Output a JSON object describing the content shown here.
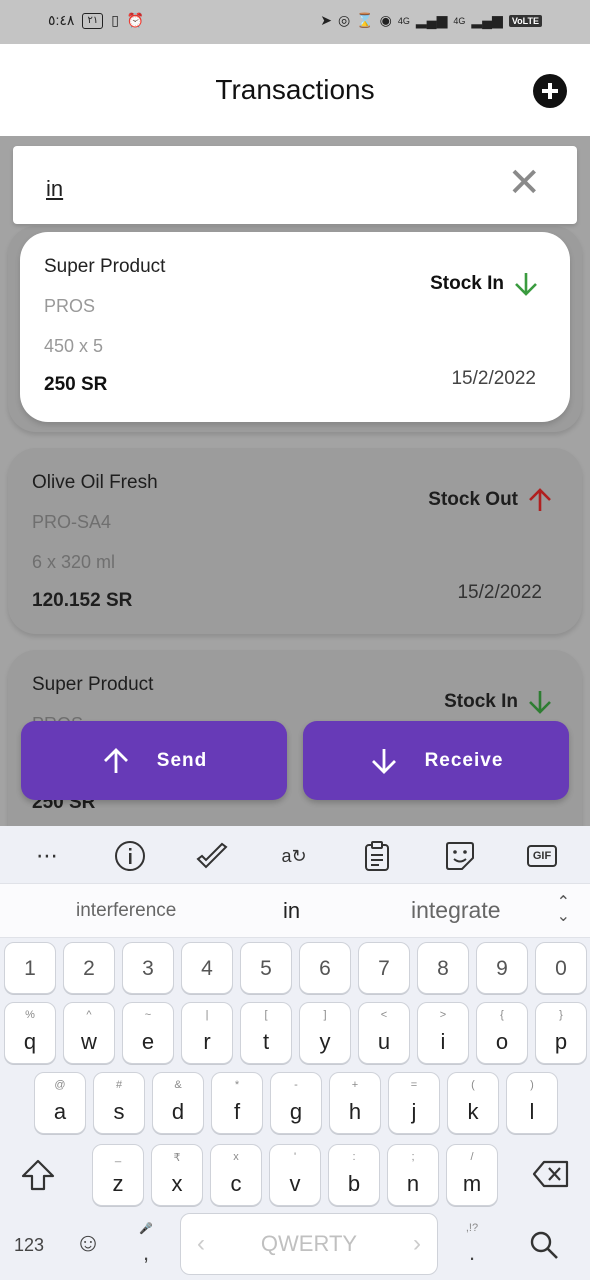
{
  "status_bar": {
    "time": "٥:٤٨",
    "battery": "٢١",
    "net1": "4G",
    "net2": "4G",
    "volte": "VoLTE"
  },
  "app_bar": {
    "title": "Transactions",
    "add_icon": "plus-circle-icon"
  },
  "search": {
    "value": "in"
  },
  "cards": [
    {
      "name": "Super Product",
      "code": "PROS",
      "qty": "450 x 5",
      "price": "250 SR",
      "date": "15/2/2022",
      "status": "Stock In",
      "direction": "down",
      "arrow_color": "#3a9b3f"
    },
    {
      "name": "Olive Oil Fresh",
      "code": "PRO-SA4",
      "qty": "6 x 320 ml",
      "price": "120.152 SR",
      "date": "15/2/2022",
      "status": "Stock Out",
      "direction": "up",
      "arrow_color": "#c62828"
    },
    {
      "name": "Super Product",
      "code": "PROS",
      "qty": "",
      "price": "250 SR",
      "date": "15/2/2022",
      "status": "Stock In",
      "direction": "down",
      "arrow_color": "#3a9b3f"
    }
  ],
  "actions": {
    "send": "Send",
    "receive": "Receive",
    "color": "#673ab7"
  },
  "keyboard": {
    "toolbar": [
      "more-icon",
      "info-icon",
      "checkmark-icon",
      "translate-icon",
      "clipboard-icon",
      "sticker-icon",
      "gif-icon"
    ],
    "gif_label": "GIF",
    "suggestions": {
      "left": "interference",
      "mid": "in",
      "right": "integrate"
    },
    "num_row": [
      "1",
      "2",
      "3",
      "4",
      "5",
      "6",
      "7",
      "8",
      "9",
      "0"
    ],
    "row1": [
      [
        "%",
        "q"
      ],
      [
        "^",
        "w"
      ],
      [
        "~",
        "e"
      ],
      [
        "|",
        "r"
      ],
      [
        "[",
        "t"
      ],
      [
        "]",
        "y"
      ],
      [
        "<",
        "u"
      ],
      [
        ">",
        "i"
      ],
      [
        "{",
        "o"
      ],
      [
        "}",
        "p"
      ]
    ],
    "row2": [
      [
        "@",
        "a"
      ],
      [
        "#",
        "s"
      ],
      [
        "&",
        "d"
      ],
      [
        "*",
        "f"
      ],
      [
        "-",
        "g"
      ],
      [
        "+",
        "h"
      ],
      [
        "=",
        "j"
      ],
      [
        "(",
        "k"
      ],
      [
        ")",
        "l"
      ]
    ],
    "row3": [
      [
        "_",
        "z"
      ],
      [
        "₹",
        "x"
      ],
      [
        "x",
        "c"
      ],
      [
        "'",
        "v"
      ],
      [
        ":",
        "b"
      ],
      [
        ";",
        "n"
      ],
      [
        "/",
        "m"
      ]
    ],
    "symbols_label": "123",
    "space_label": "QWERTY",
    "comma": ",",
    "period": ".",
    "period_hint": ",!?"
  }
}
